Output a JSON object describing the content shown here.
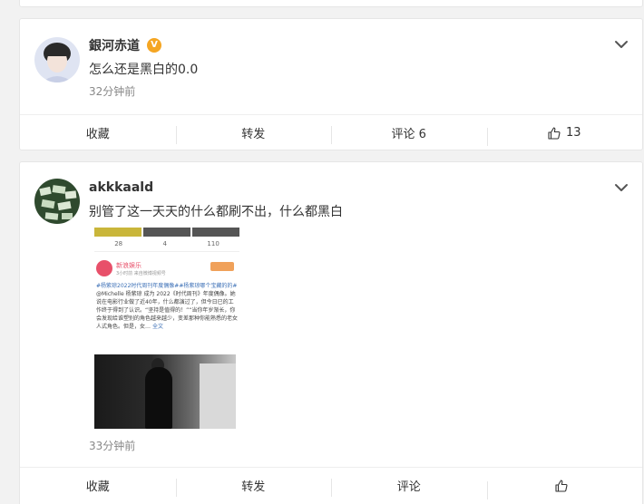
{
  "posts": [
    {
      "username": "銀河赤道",
      "verified_badge": "V",
      "text": "怎么还是黑白的0.0",
      "time": "32分钟前",
      "actions": {
        "favorite": "收藏",
        "repost": "转发",
        "comment": "评论 6",
        "like_count": "13"
      }
    },
    {
      "username": "akkkaald",
      "text": "别管了这一天天的什么都刷不出，什么都黑白",
      "time": "33分钟前",
      "image": {
        "stats": [
          "28",
          "4",
          "110"
        ],
        "account_name": "新浪娱乐",
        "account_time": "3小时前 来自微博视频号",
        "body_link": "#杨紫琼2022时代周刊年度偶像##杨紫琼哪个宝藏的的#",
        "body_text": "@Michelle 杨紫琼 成为 2022《时代周刊》年度偶像。她说在电影行业做了近40年，什么都演过了，但今日已的工作终于得到了认识。“坚持是值得的！”“当你年岁渐长，你会发现给谁塑别的角色越来越少，变差那种你能熟悉的老女人式角色。但是，女…",
        "more": "全文"
      },
      "actions": {
        "favorite": "收藏",
        "repost": "转发",
        "comment": "评论",
        "like_count": ""
      }
    }
  ],
  "colors": {
    "background": "#f2f2f2",
    "card": "#ffffff",
    "verified": "#f5a623",
    "link": "#3b6fb6"
  }
}
